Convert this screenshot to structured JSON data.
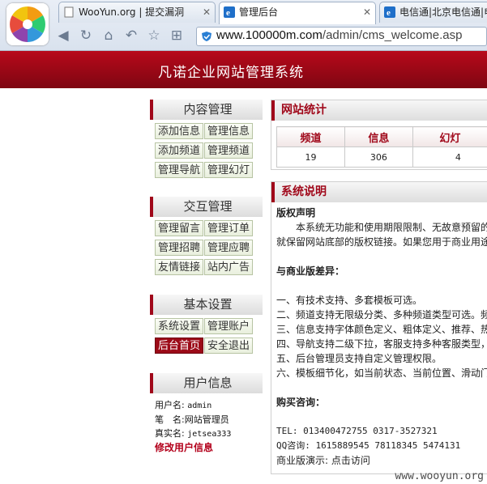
{
  "browser": {
    "tabs": [
      {
        "label": "WooYun.org | 提交漏洞",
        "icon": "page-icon"
      },
      {
        "label": "管理后台",
        "icon": "ie-icon",
        "active": true
      },
      {
        "label": "电信通|北京电信通|电",
        "icon": "ie-icon"
      }
    ],
    "address": {
      "host": "www.100000m.com",
      "path": "/admin/cms_welcome.asp"
    }
  },
  "banner": {
    "title": "凡诺企业网站管理系统"
  },
  "sidebar": {
    "content_mgmt": {
      "title": "内容管理",
      "buttons": [
        "添加信息",
        "管理信息",
        "添加频道",
        "管理频道",
        "管理导航",
        "管理幻灯"
      ]
    },
    "interaction_mgmt": {
      "title": "交互管理",
      "buttons": [
        "管理留言",
        "管理订单",
        "管理招聘",
        "管理应聘",
        "友情链接",
        "站内广告"
      ]
    },
    "basic_settings": {
      "title": "基本设置",
      "buttons": [
        "系统设置",
        "管理账户",
        "后台首页",
        "安全退出"
      ]
    },
    "user_info": {
      "title": "用户信息",
      "username_label": "用户名:",
      "username": "admin",
      "nickname_label": "笔　名:",
      "nickname": "网站管理员",
      "realname_label": "真实名:",
      "realname": "jetsea333",
      "edit_link": "修改用户信息"
    }
  },
  "stats": {
    "title": "网站统计",
    "headers": [
      "频道",
      "信息",
      "幻灯"
    ],
    "values": [
      "19",
      "306",
      "4"
    ]
  },
  "system_info": {
    "title": "系统说明",
    "copyright_title": "版权声明",
    "copyright_line1": "本系统无功能和使用期限限制、无故意预留的",
    "copyright_line2": "就保留网站底部的版权链接。如果您用于商业用途",
    "diff_title": "与商业版差异：",
    "diff_items": [
      "一、有技术支持、多套模板可选。",
      "二、频道支持无限级分类、多种频道类型可选。频",
      "三、信息支持字体颜色定义、粗体定义、推荐、热",
      "四、导航支持二级下拉，客服支持多种客服类型，",
      "五、后台管理员支持自定义管理权限。",
      "六、模板细节化，如当前状态、当前位置、滑动门"
    ],
    "contact_title": "购买咨询：",
    "tel": "TEL: 013400472755 0317-3527321",
    "qq": "QQ咨询: 1615889545 78118345 5474131",
    "demo": "商业版演示: 点击访问"
  },
  "watermark": "www.wooyun.org"
}
